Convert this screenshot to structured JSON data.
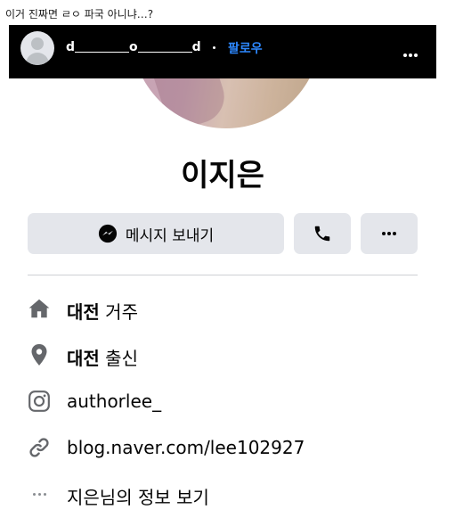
{
  "caption": "이거 진짜면 ㄹㅇ 파국 아니냐…?",
  "header": {
    "username_parts": [
      "d",
      "o",
      "d"
    ],
    "follow_label": "팔로우"
  },
  "profile": {
    "name": "이지은"
  },
  "actions": {
    "message_label": "메시지 보내기"
  },
  "intro": {
    "residence_city": "대전",
    "residence_suffix": "거주",
    "origin_city": "대전",
    "origin_suffix": "출신",
    "instagram": "authorlee_",
    "website": "blog.naver.com/lee102927",
    "see_info": "지은님의 정보 보기"
  },
  "colors": {
    "follow": "#2d88ff",
    "button_bg": "#e4e6eb",
    "icon_gray": "#65676b"
  }
}
